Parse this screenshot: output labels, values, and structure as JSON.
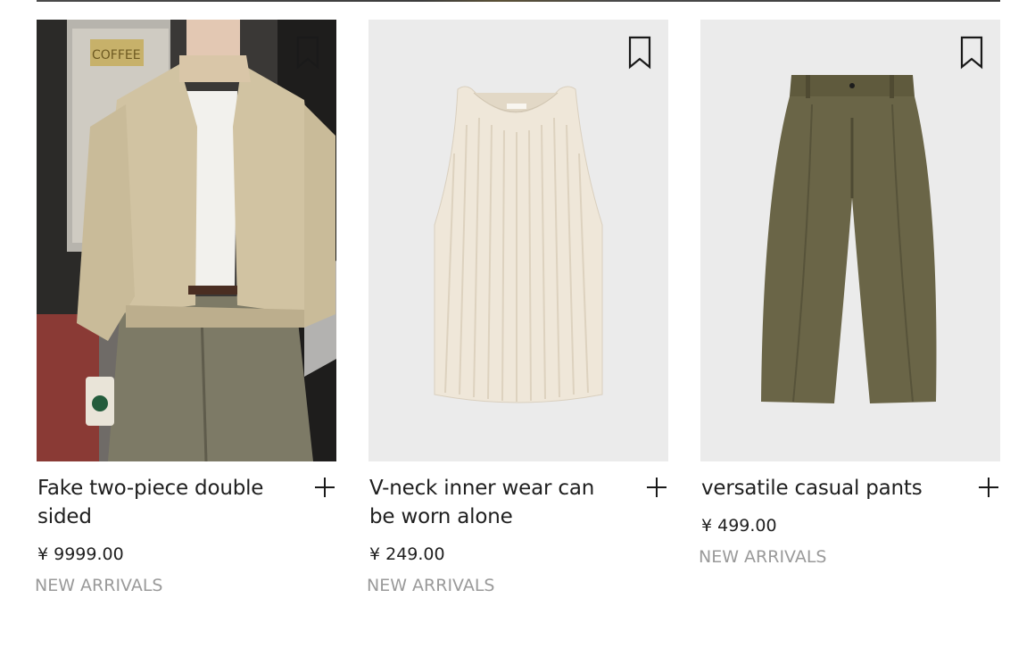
{
  "products": [
    {
      "name": "Fake two-piece double sided",
      "price": "¥ 9999.00",
      "tag": "NEW ARRIVALS",
      "image": "model-wearing-beige-jacket",
      "sign_text": "COFFEE"
    },
    {
      "name": "V-neck inner wear can be worn alone",
      "price": "¥ 249.00",
      "tag": "NEW ARRIVALS",
      "image": "cream-ribbed-tank-top"
    },
    {
      "name": "versatile casual pants",
      "price": "¥ 499.00",
      "tag": "NEW ARRIVALS",
      "image": "olive-herringbone-wide-pants"
    }
  ],
  "icons": {
    "bookmark": "bookmark-icon",
    "add": "plus-icon"
  },
  "colors": {
    "text": "#1f1f1f",
    "muted": "#9a9a9a",
    "image_bg": "#ebebeb"
  }
}
